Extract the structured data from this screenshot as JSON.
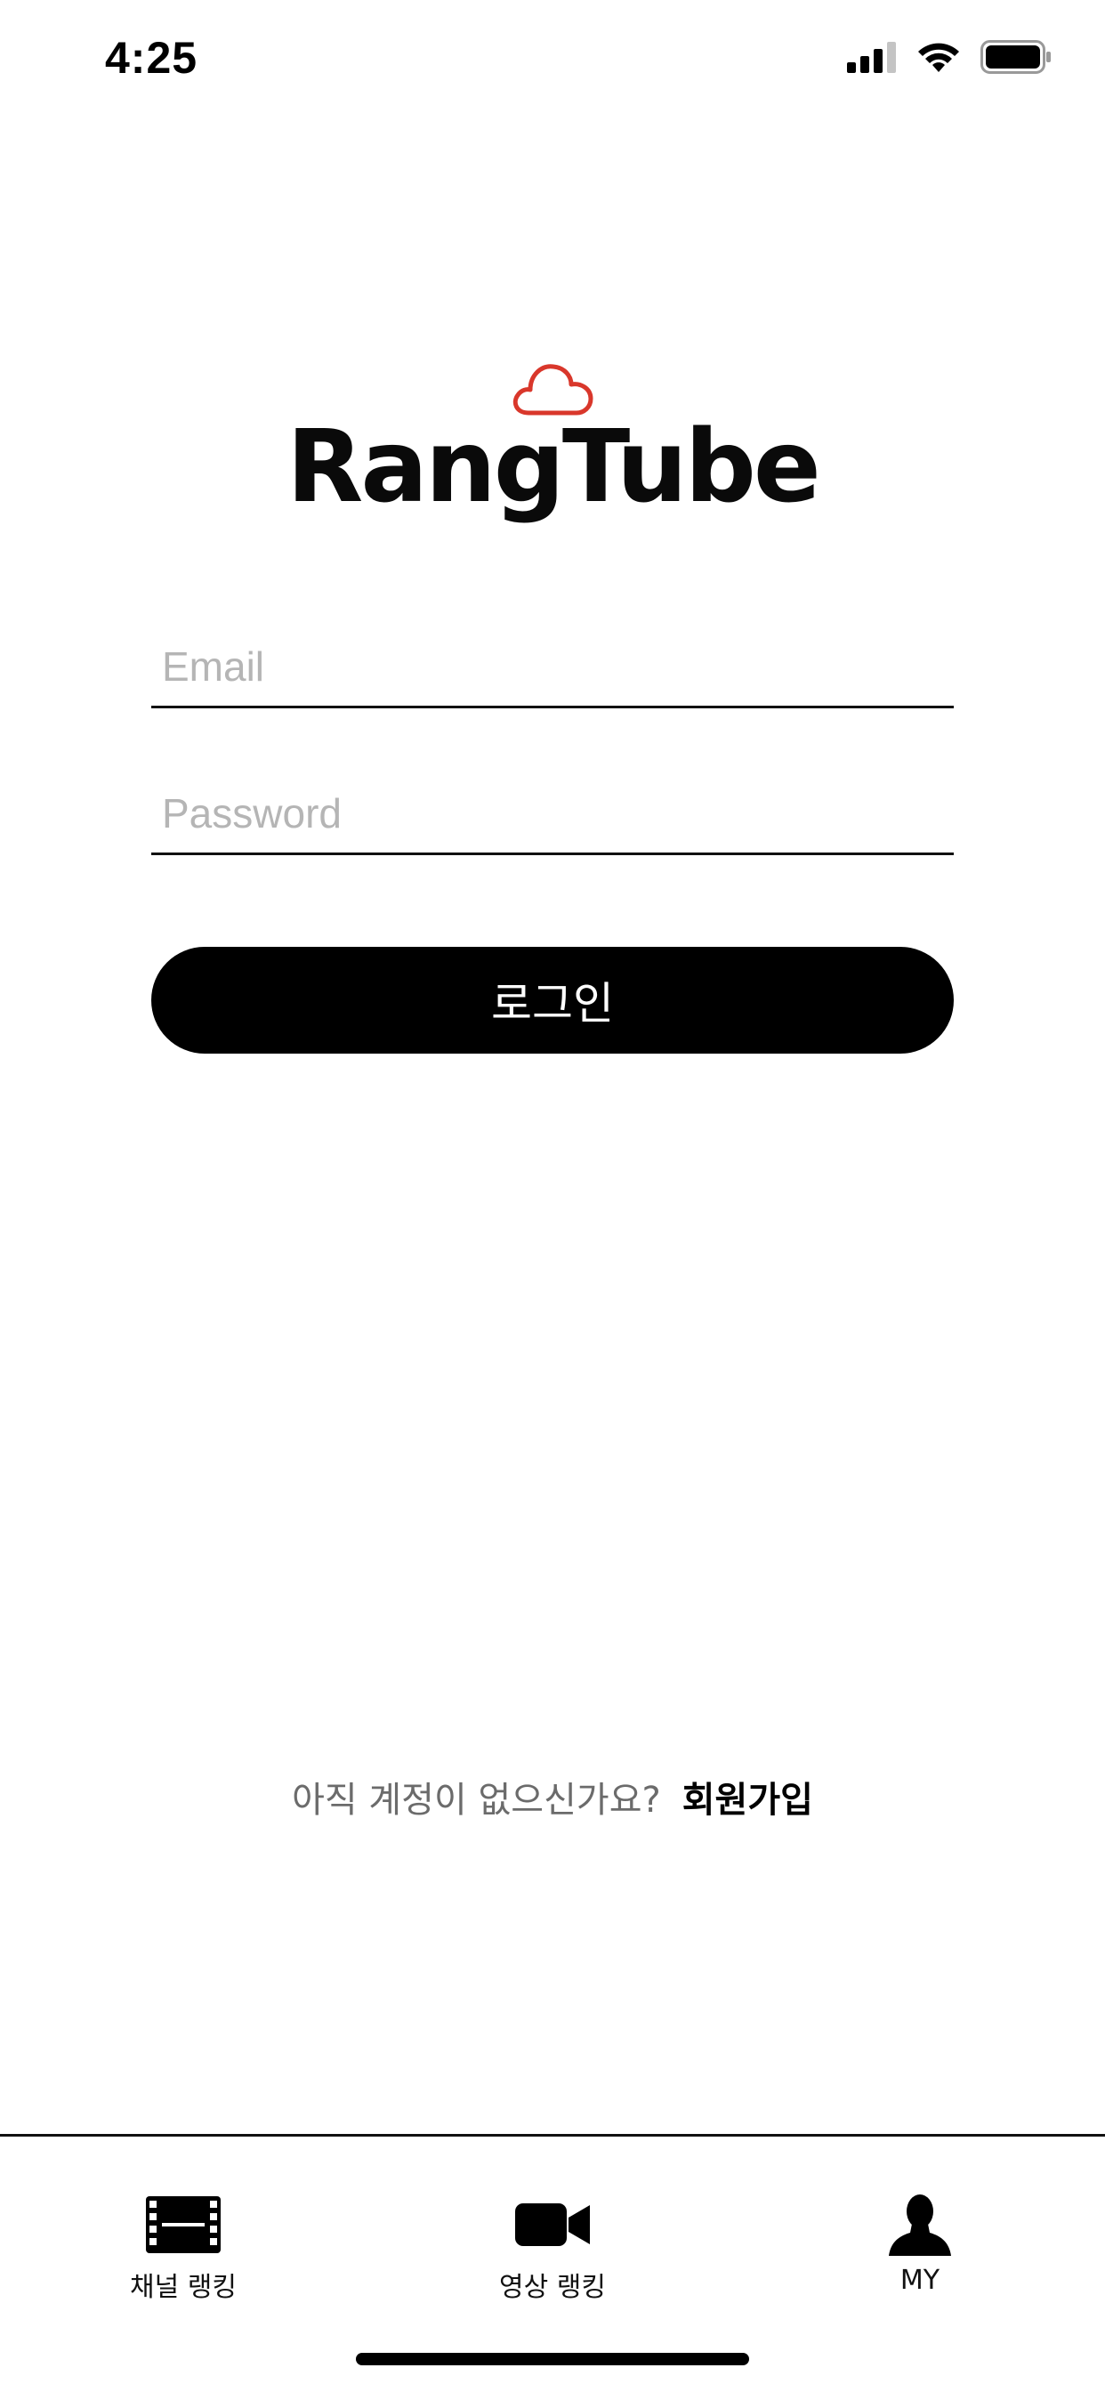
{
  "status_bar": {
    "time": "4:25",
    "icons": [
      "cellular-signal-icon",
      "wifi-icon",
      "battery-icon"
    ]
  },
  "logo": {
    "text": "RangTube",
    "icon": "cloud-icon",
    "accent_color": "#d9372b"
  },
  "login_form": {
    "email_placeholder": "Email",
    "email_value": "",
    "password_placeholder": "Password",
    "password_value": "",
    "login_label": "로그인"
  },
  "signup": {
    "prompt": "아직 계정이 없으신가요?",
    "link_label": "회원가입"
  },
  "tab_bar": {
    "tabs": [
      {
        "label": "채널 랭킹",
        "icon": "film-icon"
      },
      {
        "label": "영상 랭킹",
        "icon": "video-camera-icon"
      },
      {
        "label": "MY",
        "icon": "person-icon"
      }
    ]
  }
}
